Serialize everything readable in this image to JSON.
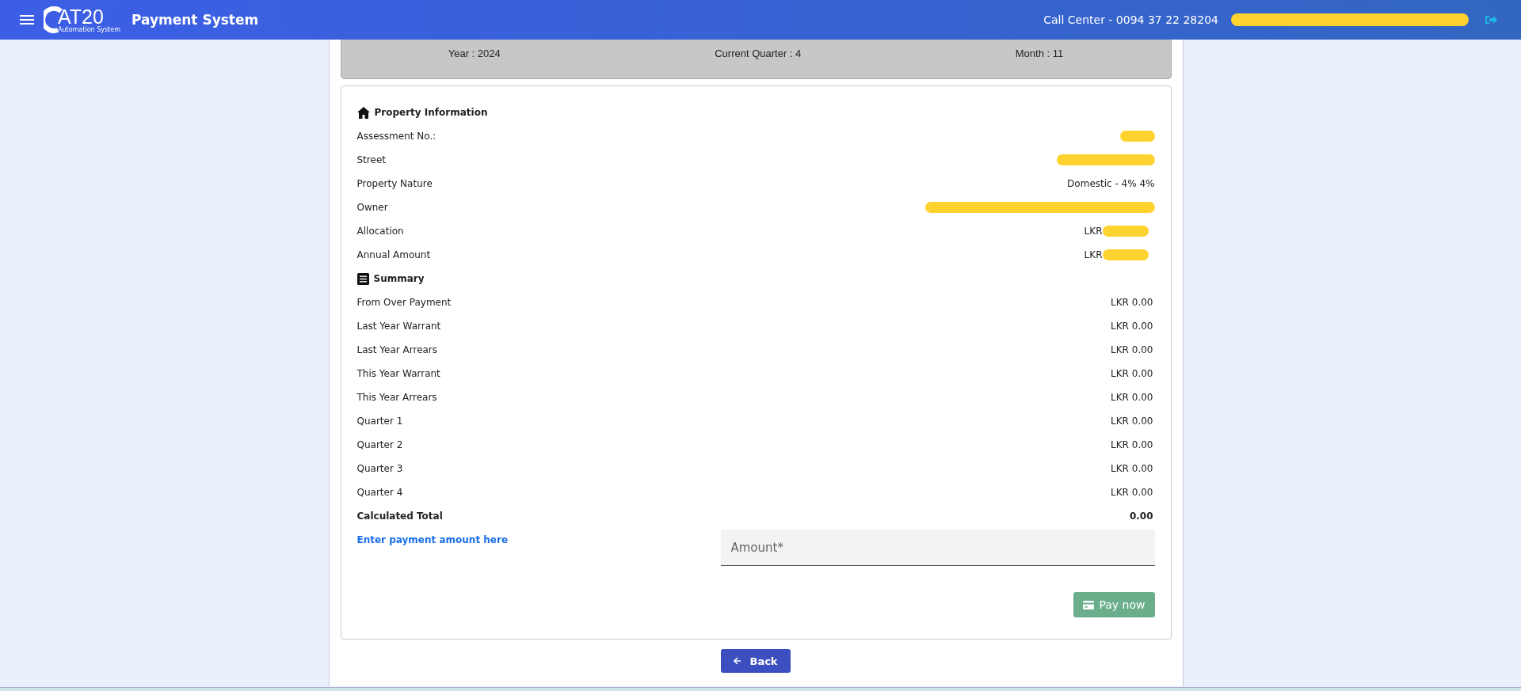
{
  "header": {
    "logo_text": "AT20",
    "logo_tagline": "Automation System",
    "title": "Payment System",
    "call_center": "Call Center - 0094 37 22 28204",
    "user_redacted": true
  },
  "period": [
    {
      "label": "Year : 2024"
    },
    {
      "label": "Current Quarter : 4"
    },
    {
      "label": "Month : 11"
    }
  ],
  "property_information": {
    "title": "Property Information",
    "rows": [
      {
        "label": "Assessment No.:",
        "redacted": true
      },
      {
        "label": "Street",
        "redacted": true
      },
      {
        "label": "Property Nature",
        "value": "Domestic - 4% 4%",
        "redacted": false
      },
      {
        "label": "Owner",
        "redacted": true
      },
      {
        "label": "Allocation",
        "value": "LKR",
        "redacted": true
      },
      {
        "label": "Annual Amount",
        "value": "LKR",
        "redacted": true
      }
    ]
  },
  "summary": {
    "title": "Summary",
    "rows": [
      {
        "label": "From Over Payment",
        "value": "LKR 0.00",
        "kind": "line"
      },
      {
        "label": "Last Year Warrant",
        "value": "LKR 0.00",
        "kind": "line"
      },
      {
        "label": "Last Year Arrears",
        "value": "LKR 0.00",
        "kind": "line"
      },
      {
        "label": "This Year Warrant",
        "value": "LKR 0.00",
        "kind": "line"
      },
      {
        "label": "This Year Arrears",
        "value": "LKR 0.00",
        "kind": "line"
      },
      {
        "label": "Quarter 1",
        "value": "LKR 0.00",
        "kind": "line"
      },
      {
        "label": "Quarter 2",
        "value": "LKR 0.00",
        "kind": "line"
      },
      {
        "label": "Quarter 3",
        "value": "LKR 0.00",
        "kind": "line"
      },
      {
        "label": "Quarter 4",
        "value": "LKR 0.00",
        "kind": "line"
      },
      {
        "label": "Calculated Total",
        "value": "0.00",
        "kind": "total"
      }
    ]
  },
  "payment": {
    "prompt": "Enter payment amount here",
    "amount_placeholder": "Amount*",
    "pay_button": "Pay now"
  },
  "back_button": "Back"
}
